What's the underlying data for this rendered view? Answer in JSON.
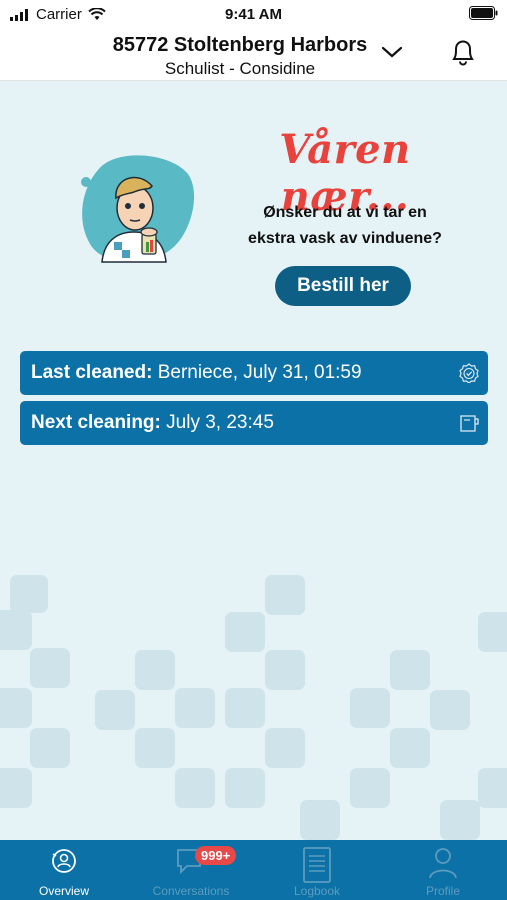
{
  "status_bar": {
    "carrier": "Carrier",
    "time": "9:41 AM"
  },
  "header": {
    "title": "85772 Stoltenberg Harbors",
    "subtitle": "Schulist - Considine"
  },
  "promo": {
    "title": "Våren nær...",
    "line1": "Ønsker du at vi tar en",
    "line2": "ekstra vask av vinduene?",
    "button": "Bestill her"
  },
  "info": {
    "last_label": "Last cleaned:",
    "last_value": " Berniece, July 31, 01:59",
    "next_label": "Next cleaning:",
    "next_value": " July 3, 23:45"
  },
  "tabs": [
    {
      "label": "Overview",
      "icon": "overview-icon",
      "active": true
    },
    {
      "label": "Conversations",
      "icon": "chat-icon",
      "badge": "999+"
    },
    {
      "label": "Logbook",
      "icon": "logbook-icon"
    },
    {
      "label": "Profile",
      "icon": "profile-icon"
    }
  ],
  "colors": {
    "primary": "#0b71a6",
    "accent": "#e8423d",
    "background": "#e6f3f6",
    "badge": "#e84848"
  }
}
